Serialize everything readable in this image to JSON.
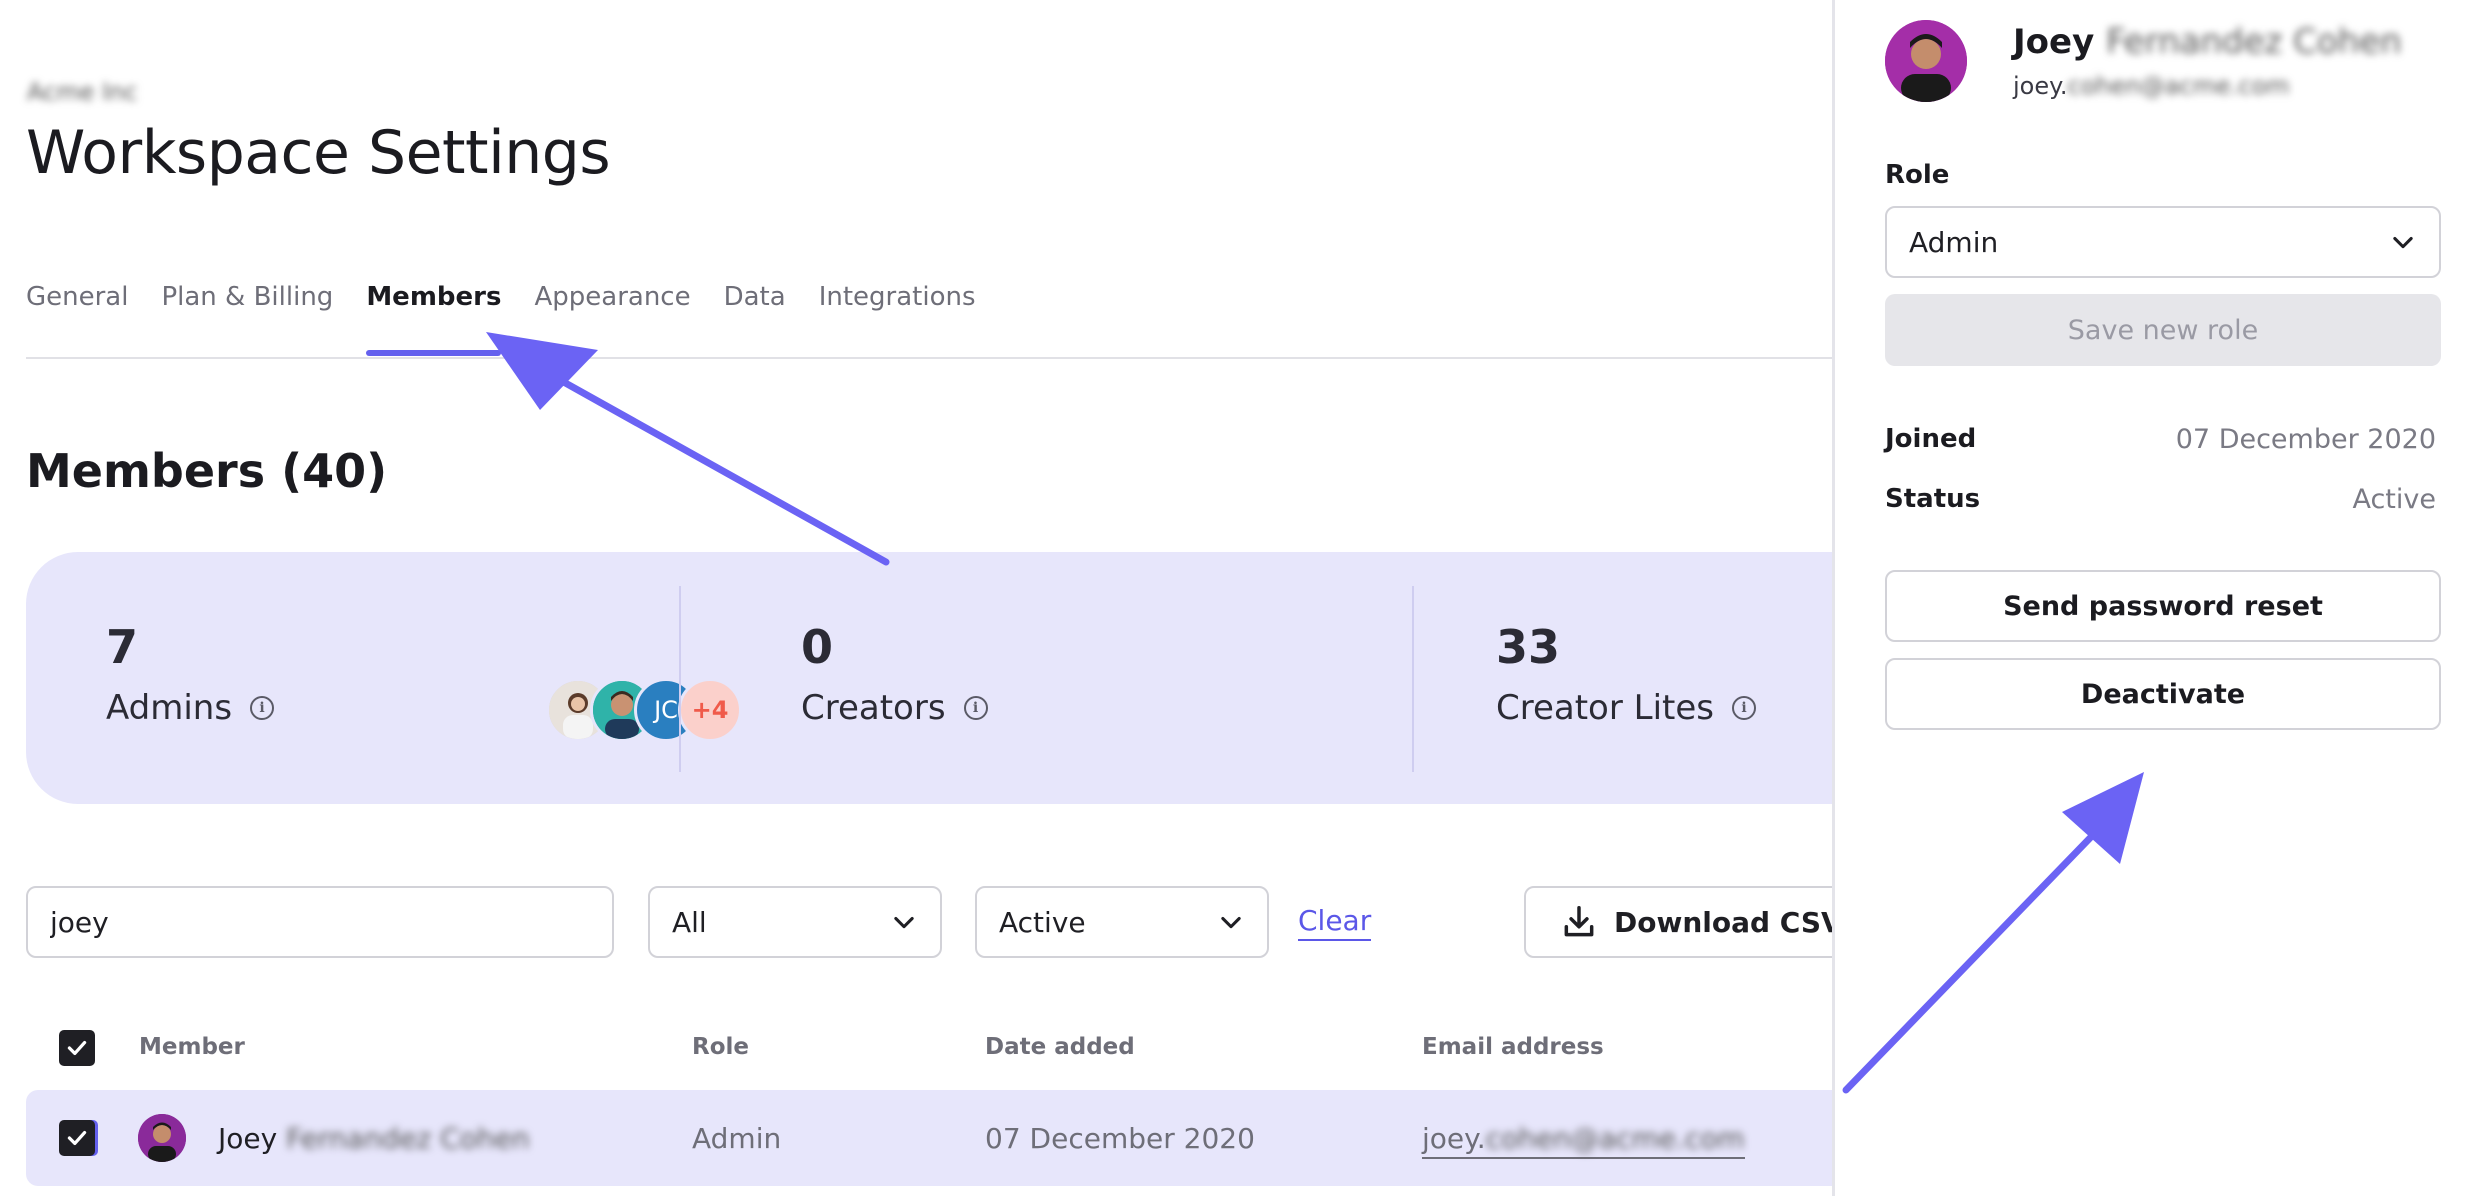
{
  "workspace": {
    "name": "Acme Inc"
  },
  "page": {
    "title": "Workspace Settings"
  },
  "tabs": [
    {
      "label": "General"
    },
    {
      "label": "Plan & Billing"
    },
    {
      "label": "Members"
    },
    {
      "label": "Appearance"
    },
    {
      "label": "Data"
    },
    {
      "label": "Integrations"
    }
  ],
  "members": {
    "heading": "Members (40)",
    "stats": {
      "admins": {
        "count": "7",
        "label": "Admins",
        "more_badge": "+4",
        "initials_badge": "JC"
      },
      "creators": {
        "count": "0",
        "label": "Creators"
      },
      "creator_lites": {
        "count": "33",
        "label": "Creator Lites"
      }
    }
  },
  "filters": {
    "search_value": "joey",
    "role_filter": "All",
    "status_filter": "Active",
    "clear_label": "Clear",
    "download_label": "Download CSV"
  },
  "table": {
    "columns": {
      "member": "Member",
      "role": "Role",
      "date_added": "Date added",
      "email": "Email address"
    },
    "rows": [
      {
        "first_name": "Joey",
        "last_name": "Fernandez Cohen",
        "role": "Admin",
        "date_added": "07 December 2020",
        "email_visible": "joey.",
        "email_hidden": "cohen@acme.com"
      }
    ]
  },
  "panel": {
    "first_name": "Joey",
    "last_name": "Fernandez Cohen",
    "email_visible": "joey.",
    "email_hidden": "cohen@acme.com",
    "role_label": "Role",
    "role_value": "Admin",
    "save_role_label": "Save new role",
    "joined_label": "Joined",
    "joined_value": "07 December 2020",
    "status_label": "Status",
    "status_value": "Active",
    "reset_label": "Send password reset",
    "deactivate_label": "Deactivate"
  },
  "colors": {
    "accent": "#6460ee",
    "card_bg": "#e7e6fb",
    "arrow": "#6b63f4"
  }
}
